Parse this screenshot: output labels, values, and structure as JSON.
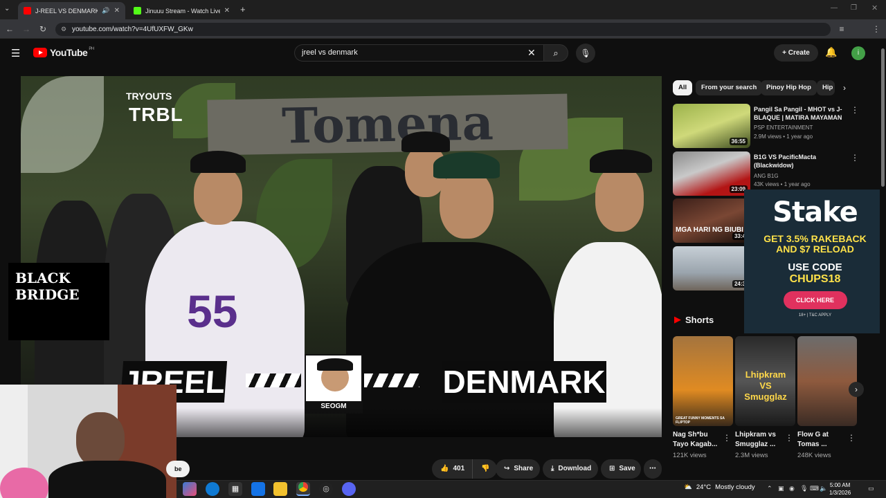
{
  "browser": {
    "tabs": [
      {
        "title": "J-REEL VS DENMARK (TRBL"
      },
      {
        "title": "Jinuuu Stream - Watch Live on"
      }
    ],
    "url": "youtube.com/watch?v=4UfUXFW_GKw"
  },
  "youtube": {
    "logo_text": "YouTube",
    "region": "PH",
    "search_value": "jreel vs denmark",
    "create_label": "Create",
    "avatar_initial": "i"
  },
  "video": {
    "overlay_tryouts": "TRYOUTS",
    "overlay_trbl": "TRBL",
    "sign_text": "Tomena",
    "left_name": "JREEL",
    "right_name": "DENMARK",
    "host_tag": "SEOGM",
    "watermark": "BLACK BRIDGE",
    "subscribe_fragment": "be"
  },
  "actions": {
    "like_count": "401",
    "share": "Share",
    "download": "Download",
    "save": "Save"
  },
  "chips": [
    "All",
    "From your search",
    "Pinoy Hip Hop",
    "Hip"
  ],
  "recommendations": [
    {
      "title": "Pangil Sa Pangil - MHOT vs J-BLAQUE | MATIRA MAYAMAN ...",
      "channel": "PSP ENTERTAINMENT",
      "meta": "2.9M views • 1 year ago",
      "duration": "36:55"
    },
    {
      "title": "B1G VS PacificMacta (Blackwidow)",
      "channel": "ANG B1G",
      "meta": "43K views • 1 year ago",
      "duration": "23:09"
    },
    {
      "title": "",
      "channel": "",
      "meta": "",
      "duration": "33:4"
    },
    {
      "title": "",
      "channel": "",
      "meta": "",
      "duration": "24:3"
    }
  ],
  "thumb_captions": {
    "rec3": "MGA HARI NG BIUBI"
  },
  "ad": {
    "brand": "Stake",
    "offer_line1": "GET 3.5% RAKEBACK",
    "offer_line2": "AND $7 RELOAD",
    "code_label": "USE CODE",
    "code": "CHUPS18",
    "cta": "CLICK HERE",
    "disclaimer": "18+ | T&C APPLY"
  },
  "shorts": {
    "heading": "Shorts",
    "items": [
      {
        "title": "Nag Sh*bu Tayo Kagab...",
        "views": "121K views",
        "caption": "GREAT FUNNY MOMENTS SA FLIPTOP"
      },
      {
        "title": "Lhipkram vs Smugglaz ...",
        "views": "2.3M views",
        "caption": "Lhipkram VS Smugglaz"
      },
      {
        "title": "Flow G at Tomas ...",
        "views": "248K views",
        "caption": ""
      }
    ]
  },
  "taskbar": {
    "temperature": "24°C",
    "weather": "Mostly cloudy",
    "time": "5:00 AM",
    "date": "1/3/2026"
  },
  "colors": {
    "yt_red": "#ff0000",
    "page_bg": "#0f0f0f",
    "stake_bg": "#1a2c38",
    "stake_yellow": "#ffe249",
    "stake_cta": "#e0315e"
  }
}
